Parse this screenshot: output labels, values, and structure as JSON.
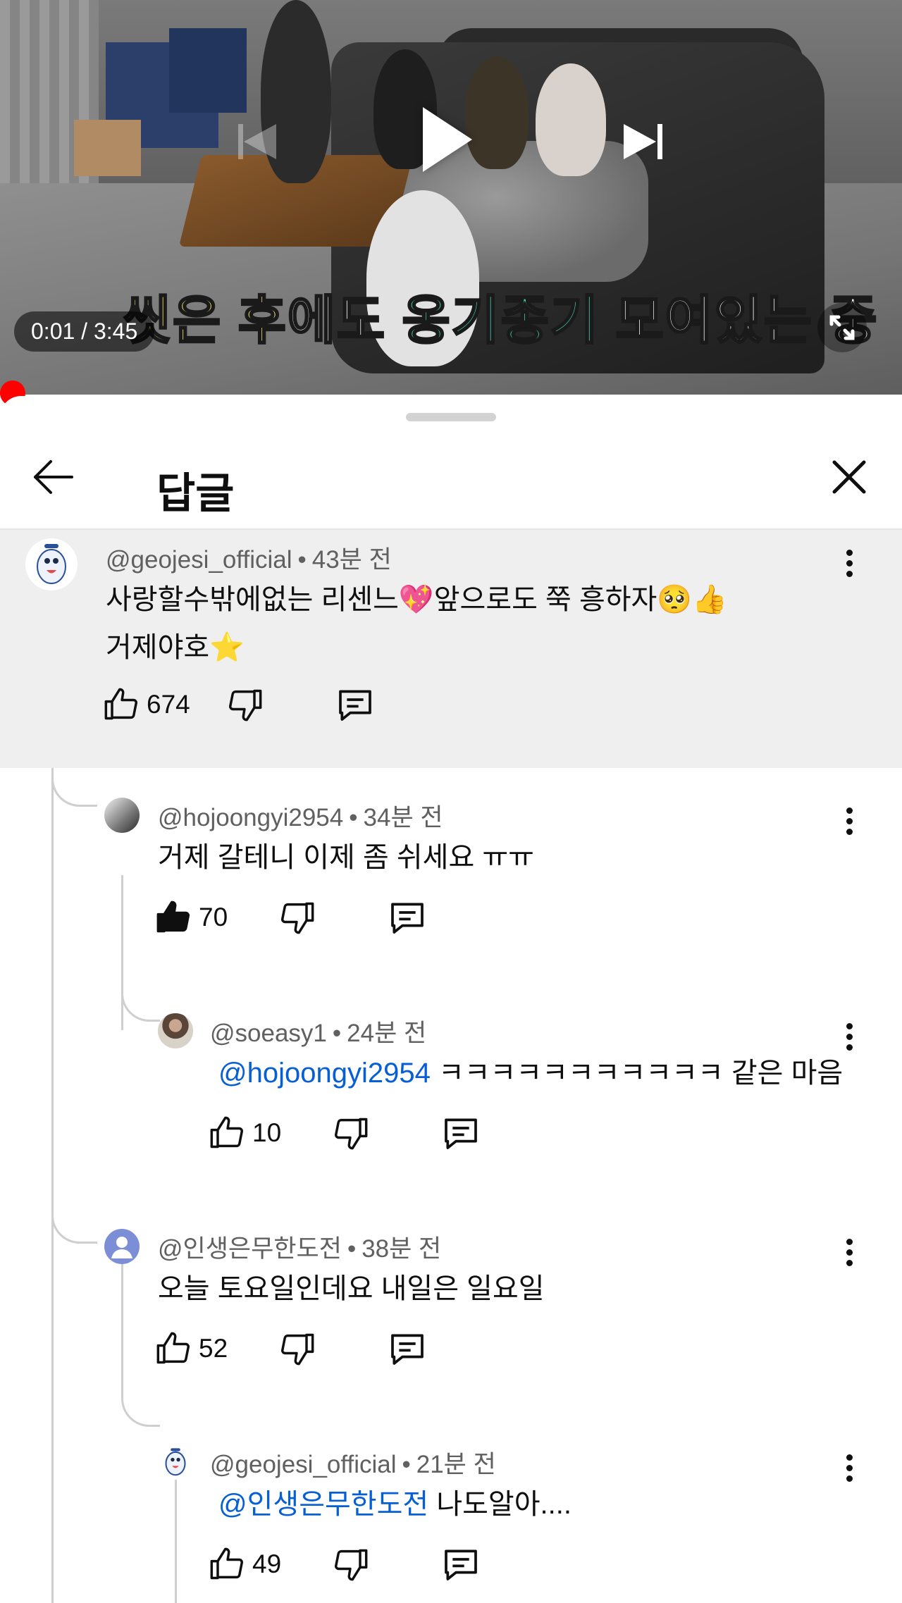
{
  "video": {
    "subtitle_parts": [
      "씻은 ",
      "후",
      "에도 ",
      "옹기종기",
      " 모여있는 중"
    ],
    "time": "0:01 / 3:45",
    "progress": 0.005
  },
  "sheet": {
    "title": "답글"
  },
  "comments": [
    {
      "author": "@geojesi_official",
      "time": "43분 전",
      "lines": [
        "사랑할수밖에없는 리센느💖앞으로도 쭉 흥하자🥺👍",
        "거제야호⭐"
      ],
      "likes": "674",
      "liked": false
    },
    {
      "author": "@hojoongyi2954",
      "time": "34분 전",
      "text": "거제 갈테니 이제 좀 쉬세요 ㅠㅠ",
      "likes": "70",
      "liked": true
    },
    {
      "author": "@soeasy1",
      "time": "24분 전",
      "mention": "@hojoongyi2954",
      "text": " ㅋㅋㅋㅋㅋㅋㅋㅋㅋㅋㅋ 같은 마음",
      "likes": "10",
      "liked": false
    },
    {
      "author": "@인생은무한도전",
      "time": "38분 전",
      "text": "오늘 토요일인데요 내일은 일요일",
      "likes": "52",
      "liked": false
    },
    {
      "author": "@geojesi_official",
      "time": "21분 전",
      "mention": "@인생은무한도전",
      "text": " 나도알아....",
      "likes": "49",
      "liked": false
    }
  ],
  "meta_separator": "•",
  "icons": [
    "play-icon",
    "previous-icon",
    "next-icon",
    "fullscreen-icon",
    "back-arrow-icon",
    "close-icon",
    "like-icon",
    "dislike-icon",
    "reply-icon",
    "more-vert-icon"
  ],
  "colors": {
    "accent_red": "#ff0000",
    "mention_blue": "#065fd4",
    "highlight_bg": "#efefef"
  }
}
